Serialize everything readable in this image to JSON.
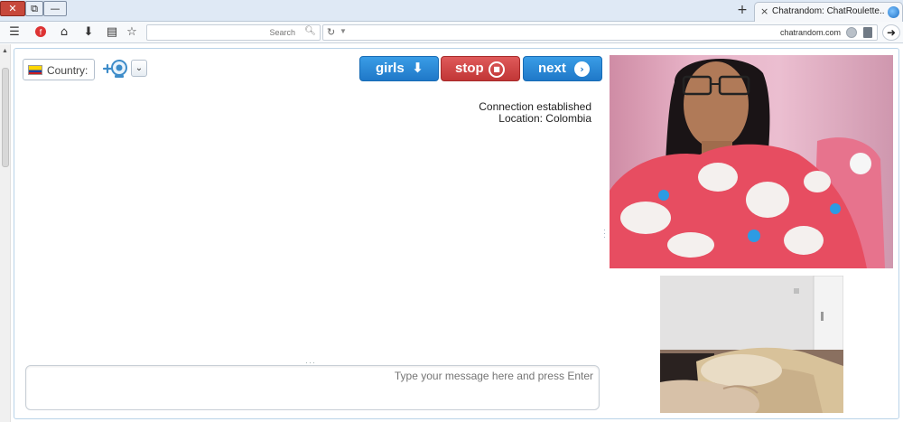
{
  "window": {
    "close_label": "✕",
    "max_label": "⧉",
    "min_label": "—"
  },
  "tab": {
    "title": "Chatrandom: ChatRoulette...",
    "close_label": "×",
    "new_tab_label": "+"
  },
  "navbar": {
    "search_placeholder": "Search",
    "url": "chatrandom.com"
  },
  "controls": {
    "next_label": "next",
    "stop_label": "stop",
    "girls_label": "girls",
    "country_label": "Country:",
    "country_flag": "colombia-flag-icon"
  },
  "status": {
    "line1": "Connection established",
    "line2": "Location: Colombia"
  },
  "chat": {
    "placeholder": "Type your message here and press Enter"
  },
  "colors": {
    "next_button": "#1f78c8",
    "stop_button": "#c13636",
    "girls_button": "#1f78c8",
    "frame_border": "#b9d3e8"
  },
  "icons": {
    "menu": "hamburger-menu-icon",
    "extension": "extension-icon",
    "home": "home-icon",
    "download": "download-icon",
    "reader": "reader-icon",
    "bookmark": "star-icon",
    "search": "search-icon",
    "reload": "reload-icon",
    "back": "back-arrow-icon"
  }
}
